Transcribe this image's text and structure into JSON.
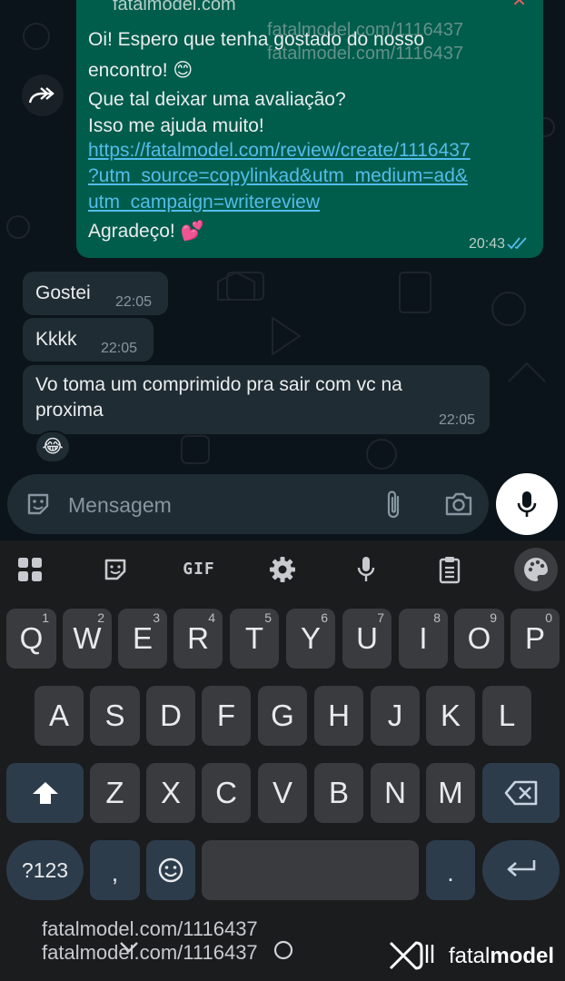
{
  "chat": {
    "outgoing": {
      "ref_preview": "fatalmodel.com",
      "lines": [
        "Oi! Espero que tenha gostado do nosso",
        "encontro! 😊",
        "Que tal deixar uma avaliação?",
        "Isso me ajuda muito!"
      ],
      "link_lines": [
        "https://fatalmodel.com/review/create/1116437",
        "?utm_source=copylinkad&utm_medium=ad&",
        "utm_campaign=writereview"
      ],
      "closing": "Agradeço! 💕",
      "time": "20:43"
    },
    "incoming": [
      {
        "text": "Gostei",
        "time": "22:05"
      },
      {
        "text": "Kkkk",
        "time": "22:05"
      },
      {
        "text_lines": [
          "Vo toma um comprimido pra sair com vc na",
          "proxima"
        ],
        "time": "22:05",
        "reaction": "😂"
      }
    ]
  },
  "input": {
    "placeholder": "Mensagem"
  },
  "keyboard": {
    "toolbar_gif": "GIF",
    "row1": [
      {
        "k": "Q",
        "n": "1"
      },
      {
        "k": "W",
        "n": "2"
      },
      {
        "k": "E",
        "n": "3"
      },
      {
        "k": "R",
        "n": "4"
      },
      {
        "k": "T",
        "n": "5"
      },
      {
        "k": "Y",
        "n": "6"
      },
      {
        "k": "U",
        "n": "7"
      },
      {
        "k": "I",
        "n": "8"
      },
      {
        "k": "O",
        "n": "9"
      },
      {
        "k": "P",
        "n": "0"
      }
    ],
    "row2": [
      "A",
      "S",
      "D",
      "F",
      "G",
      "H",
      "J",
      "K",
      "L"
    ],
    "row3": [
      "Z",
      "X",
      "C",
      "V",
      "B",
      "N",
      "M"
    ],
    "sym_label": "?123",
    "comma": ",",
    "period": "."
  },
  "watermark": {
    "text1": "fatalmodel.com/1116437",
    "text2": "fatalmodel.com/1116437",
    "top1": "fatalmodel.com/1116437",
    "top2": "fatalmodel.com/1116437",
    "brand_fatal": "fatal",
    "brand_model": "model"
  }
}
